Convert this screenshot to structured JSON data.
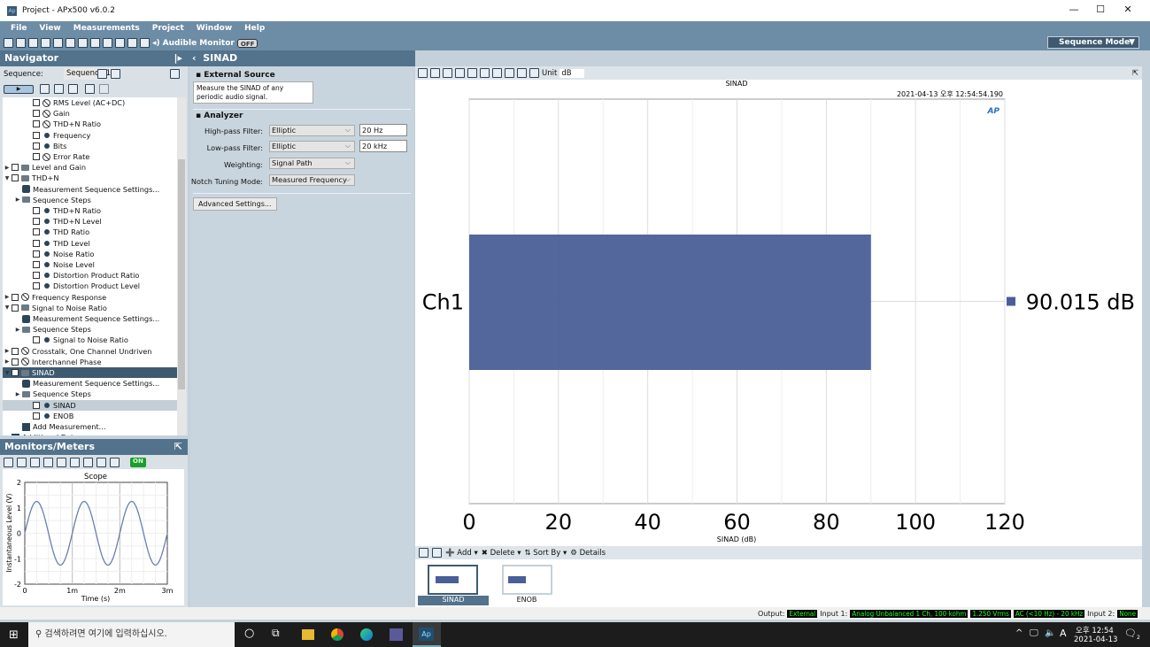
{
  "window": {
    "title": "Project - APx500 v6.0.2",
    "minimize": "—",
    "maximize": "☐",
    "close": "✕"
  },
  "menu": [
    "File",
    "View",
    "Measurements",
    "Project",
    "Window",
    "Help"
  ],
  "toolbar": {
    "audible_monitor": "Audible Monitor",
    "audible_state": "OFF",
    "sequence_mode": "Sequence Mode"
  },
  "navigator": {
    "title": "Navigator",
    "sequence_label": "Sequence:",
    "sequence_value": "Sequence 1",
    "tree": [
      {
        "l": 3,
        "e": "",
        "c": 1,
        "i": "slash",
        "t": "RMS Level (AC+DC)"
      },
      {
        "l": 3,
        "e": "",
        "c": 1,
        "i": "slash",
        "t": "Gain"
      },
      {
        "l": 3,
        "e": "",
        "c": 1,
        "i": "slash",
        "t": "THD+N Ratio"
      },
      {
        "l": 3,
        "e": "",
        "c": 1,
        "i": "dot",
        "t": "Frequency"
      },
      {
        "l": 3,
        "e": "",
        "c": 1,
        "i": "dot",
        "t": "Bits"
      },
      {
        "l": 3,
        "e": "",
        "c": 1,
        "i": "slash",
        "t": "Error Rate"
      },
      {
        "l": 1,
        "e": "▶",
        "c": 1,
        "i": "folder",
        "t": "Level and Gain"
      },
      {
        "l": 1,
        "e": "▼",
        "c": 1,
        "i": "folder",
        "t": "THD+N"
      },
      {
        "l": 2,
        "e": "",
        "c": 0,
        "i": "gear",
        "t": "Measurement Sequence Settings..."
      },
      {
        "l": 2,
        "e": "▶",
        "c": 0,
        "i": "folder",
        "t": "Sequence Steps"
      },
      {
        "l": 3,
        "e": "",
        "c": 1,
        "i": "dot",
        "t": "THD+N Ratio"
      },
      {
        "l": 3,
        "e": "",
        "c": 1,
        "i": "dot",
        "t": "THD+N Level"
      },
      {
        "l": 3,
        "e": "",
        "c": 1,
        "i": "dot",
        "t": "THD Ratio"
      },
      {
        "l": 3,
        "e": "",
        "c": 1,
        "i": "dot",
        "t": "THD Level"
      },
      {
        "l": 3,
        "e": "",
        "c": 1,
        "i": "dot",
        "t": "Noise Ratio"
      },
      {
        "l": 3,
        "e": "",
        "c": 1,
        "i": "dot",
        "t": "Noise Level"
      },
      {
        "l": 3,
        "e": "",
        "c": 1,
        "i": "dot",
        "t": "Distortion Product Ratio"
      },
      {
        "l": 3,
        "e": "",
        "c": 1,
        "i": "dot",
        "t": "Distortion Product Level"
      },
      {
        "l": 1,
        "e": "▶",
        "c": 1,
        "i": "slash",
        "t": "Frequency Response"
      },
      {
        "l": 1,
        "e": "▼",
        "c": 1,
        "i": "folder",
        "t": "Signal to Noise Ratio"
      },
      {
        "l": 2,
        "e": "",
        "c": 0,
        "i": "gear",
        "t": "Measurement Sequence Settings..."
      },
      {
        "l": 2,
        "e": "▶",
        "c": 0,
        "i": "folder",
        "t": "Sequence Steps"
      },
      {
        "l": 3,
        "e": "",
        "c": 1,
        "i": "dot",
        "t": "Signal to Noise Ratio"
      },
      {
        "l": 1,
        "e": "▶",
        "c": 1,
        "i": "slash",
        "t": "Crosstalk, One Channel Undriven"
      },
      {
        "l": 1,
        "e": "▶",
        "c": 1,
        "i": "slash",
        "t": "Interchannel Phase"
      },
      {
        "l": 1,
        "e": "▼",
        "c": 1,
        "i": "folder",
        "t": "SINAD",
        "s": "sel"
      },
      {
        "l": 2,
        "e": "",
        "c": 0,
        "i": "gear",
        "t": "Measurement Sequence Settings..."
      },
      {
        "l": 2,
        "e": "▶",
        "c": 0,
        "i": "folder",
        "t": "Sequence Steps"
      },
      {
        "l": 3,
        "e": "",
        "c": 1,
        "i": "dot",
        "t": "SINAD",
        "s": "hl"
      },
      {
        "l": 3,
        "e": "",
        "c": 1,
        "i": "dot",
        "t": "ENOB"
      },
      {
        "l": 2,
        "e": "",
        "c": 0,
        "i": "add",
        "t": "Add Measurement..."
      },
      {
        "l": 1,
        "e": "",
        "c": 0,
        "i": "add",
        "t": "Additional Data..."
      }
    ]
  },
  "monitors": {
    "title": "Monitors/Meters",
    "state": "ON"
  },
  "scope": {
    "title": "Scope",
    "xlabel": "Time (s)",
    "ylabel": "Instantaneous Level (V)",
    "xticks": [
      "0",
      "1m",
      "2m",
      "3m"
    ],
    "yticks": [
      "2",
      "1",
      "0",
      "-1",
      "-2"
    ],
    "frequency_hz": 1000,
    "amplitude_v": 1.25,
    "xlim_s": [
      0,
      0.003
    ],
    "ylim": [
      -2,
      2
    ]
  },
  "panel": {
    "title": "SINAD",
    "external_source": "External Source",
    "description": "Measure the SINAD of any periodic audio signal.",
    "analyzer": "Analyzer",
    "high_pass_label": "High-pass Filter:",
    "high_pass_value": "Elliptic",
    "high_pass_freq": "20 Hz",
    "low_pass_label": "Low-pass Filter:",
    "low_pass_value": "Elliptic",
    "low_pass_freq": "20 kHz",
    "weighting_label": "Weighting:",
    "weighting_value": "Signal Path",
    "notch_label": "Notch Tuning Mode:",
    "notch_value": "Measured Frequency",
    "advanced": "Advanced Settings..."
  },
  "chart_toolbar": {
    "unit_label": "Unit",
    "unit_value": "dB"
  },
  "chart_data": {
    "type": "bar",
    "orientation": "horizontal",
    "title": "SINAD",
    "timestamp": "2021-04-13 오후 12:54:54.190",
    "categories": [
      "Ch1"
    ],
    "values": [
      90.015
    ],
    "value_label": "90.015 dB",
    "xlabel": "SINAD (dB)",
    "xlim": [
      0,
      120
    ],
    "xticks": [
      "0",
      "20",
      "40",
      "60",
      "80",
      "100",
      "120"
    ],
    "grid": true,
    "color": "#4a5f98",
    "legend": "right"
  },
  "list_toolbar": {
    "add": "Add",
    "delete": "Delete",
    "sort_by": "Sort By",
    "details": "Details"
  },
  "results": [
    {
      "label": "SINAD",
      "selected": true
    },
    {
      "label": "ENOB",
      "selected": false
    }
  ],
  "status": {
    "output_label": "Output:",
    "output": "External",
    "input1_label": "Input 1:",
    "input1": "Analog Unbalanced 1 Ch, 100 kohm",
    "level": "1.250 Vrms",
    "bandwidth": "AC (<10 Hz) - 20 kHz",
    "input2_label": "Input 2:",
    "input2": "None"
  },
  "taskbar": {
    "search_placeholder": "검색하려면 여기에 입력하십시오.",
    "time": "오후 12:54",
    "date": "2021-04-13",
    "ime": "A",
    "notifications": "2"
  }
}
